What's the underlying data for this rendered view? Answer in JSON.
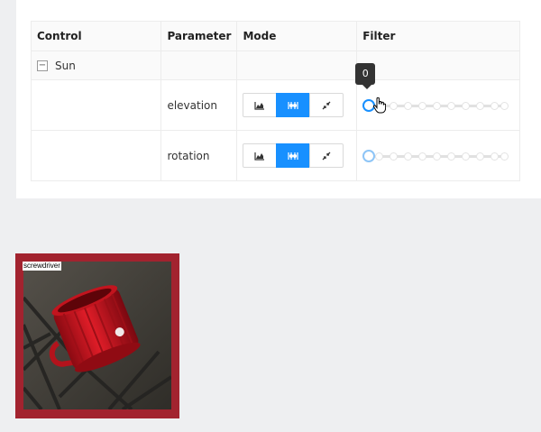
{
  "table": {
    "headers": [
      "Control",
      "Parameter",
      "Mode",
      "Filter"
    ],
    "group": {
      "name": "Sun",
      "toggle": "−"
    },
    "rows": [
      {
        "parameter": "elevation",
        "tooltip": "0",
        "active_mode": "sliders"
      },
      {
        "parameter": "rotation",
        "active_mode": "sliders"
      }
    ],
    "mode_icons": [
      "chart-icon",
      "sliders-icon",
      "shrink-icon"
    ]
  },
  "colors": {
    "accent": "#1890ff",
    "frame": "#a2232f",
    "page_bg": "#eeeff1"
  },
  "image": {
    "label": "screwdriver"
  }
}
